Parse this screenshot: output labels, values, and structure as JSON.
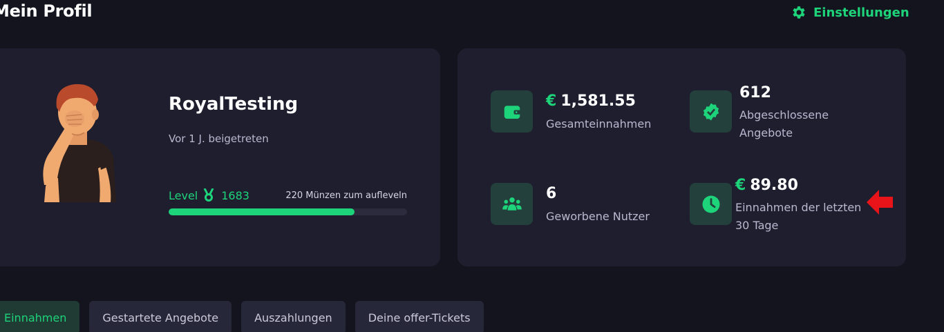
{
  "header": {
    "title": "Mein Profil",
    "settings_label": "Einstellungen"
  },
  "profile": {
    "username": "RoyalTesting",
    "joined": "Vor 1 J. beigetreten",
    "level_label": "Level",
    "level_value": "1683",
    "level_hint": "220 Münzen zum aufleveln",
    "progress_fraction": 0.78
  },
  "stats": {
    "total_earnings": {
      "currency": "€",
      "value": "1,581.55",
      "label": "Gesamteinnahmen",
      "icon": "wallet-icon"
    },
    "completed_offers": {
      "value": "612",
      "label_line1": "Abgeschlossene",
      "label_line2": "Angebote",
      "icon": "verified-badge-icon"
    },
    "referred_users": {
      "value": "6",
      "label": "Geworbene Nutzer",
      "icon": "users-icon"
    },
    "last_30_days": {
      "currency": "€",
      "value": "89.80",
      "label_line1": "Einnahmen der letzten",
      "label_line2": "30 Tage",
      "icon": "clock-icon"
    }
  },
  "tabs": [
    {
      "label": "Einnahmen",
      "active": true
    },
    {
      "label": "Gestartete Angebote",
      "active": false
    },
    {
      "label": "Auszahlungen",
      "active": false
    },
    {
      "label": "Deine offer-Tickets",
      "active": false
    }
  ],
  "colors": {
    "background": "#14141f",
    "card": "#1e1e2f",
    "accent": "#1ed47a",
    "icon_tile": "#23403c",
    "arrow": "#e8141a"
  }
}
